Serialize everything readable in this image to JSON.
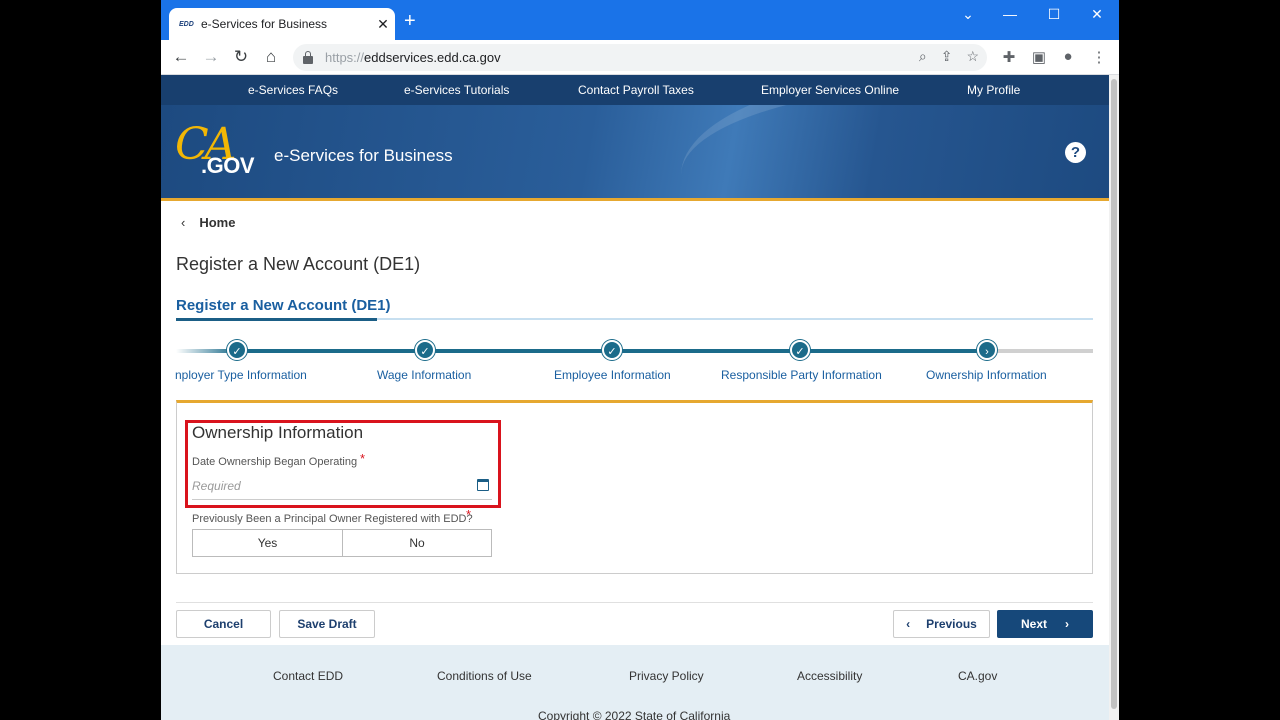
{
  "browser": {
    "tab_favicon": "EDD",
    "tab_title": "e-Services for Business",
    "tab_close": "✕",
    "new_tab": "+",
    "url_protocol": "https://",
    "url_host": "eddservices.edd.ca.gov"
  },
  "topnav": {
    "items": [
      "e-Services FAQs",
      "e-Services Tutorials",
      "Contact Payroll Taxes",
      "Employer Services Online",
      "My Profile"
    ]
  },
  "header": {
    "logo_ca": "CA",
    "logo_gov": ".GOV",
    "site_title": "e-Services for Business",
    "help": "?"
  },
  "breadcrumb": {
    "label": "Home"
  },
  "page": {
    "title": "Register a New Account (DE1)",
    "subtab": "Register a New Account (DE1)"
  },
  "steps": {
    "items": [
      {
        "label": "nployer Type Information",
        "status": "complete"
      },
      {
        "label": "Wage Information",
        "status": "complete"
      },
      {
        "label": "Employee Information",
        "status": "complete"
      },
      {
        "label": "Responsible Party Information",
        "status": "complete"
      },
      {
        "label": "Ownership Information",
        "status": "current"
      }
    ]
  },
  "form": {
    "section_title": "Ownership Information",
    "date_label": "Date Ownership Began Operating",
    "date_placeholder": "Required",
    "principal_label": "Previously Been a Principal Owner Registered with EDD?",
    "yes": "Yes",
    "no": "No",
    "required_marker": "*"
  },
  "actions": {
    "cancel": "Cancel",
    "save_draft": "Save Draft",
    "previous": "Previous",
    "next": "Next"
  },
  "footer": {
    "links": [
      "Contact EDD",
      "Conditions of Use",
      "Privacy Policy",
      "Accessibility",
      "CA.gov"
    ],
    "copyright": "Copyright © 2022 State of California"
  },
  "colors": {
    "nav_bg": "#183f6e",
    "accent_gold": "#e6a830",
    "step_teal": "#1b6b8a",
    "highlight_red": "#d9131d",
    "primary_button": "#16487a"
  }
}
